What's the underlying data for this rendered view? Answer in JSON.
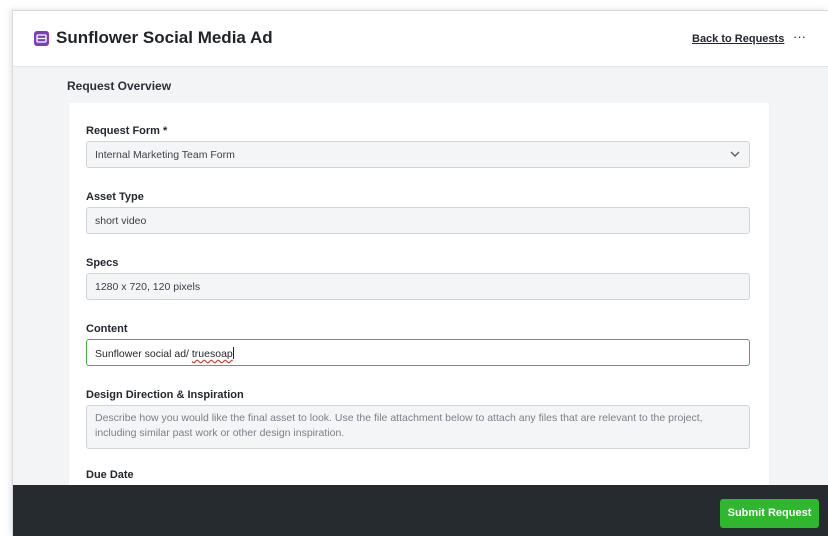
{
  "header": {
    "title": "Sunflower Social Media Ad",
    "back_link": "Back to Requests",
    "more_menu": "···",
    "app_icon": "request-icon"
  },
  "section": {
    "title": "Request Overview"
  },
  "form": {
    "request_form": {
      "label": "Request Form *",
      "value": "Internal Marketing Team Form"
    },
    "asset_type": {
      "label": "Asset Type",
      "value": "short video"
    },
    "specs": {
      "label": "Specs",
      "value": "1280 x 720, 120 pixels"
    },
    "content": {
      "label": "Content",
      "value_prefix": "Sunflower social ad/ ",
      "value_misspelled": "truesoap"
    },
    "design_direction": {
      "label": "Design Direction & Inspiration",
      "placeholder": "Describe how you would like the final asset to look. Use the file attachment below to attach any files that are relevant to the project, including similar past work or other design inspiration."
    },
    "due_date": {
      "label": "Due Date"
    }
  },
  "footer": {
    "submit_label": "Submit Request"
  },
  "colors": {
    "accent": "#2eb82e",
    "brand": "#7b3fb6",
    "footer_bg": "#262b30",
    "active_border": "#3fb540"
  }
}
